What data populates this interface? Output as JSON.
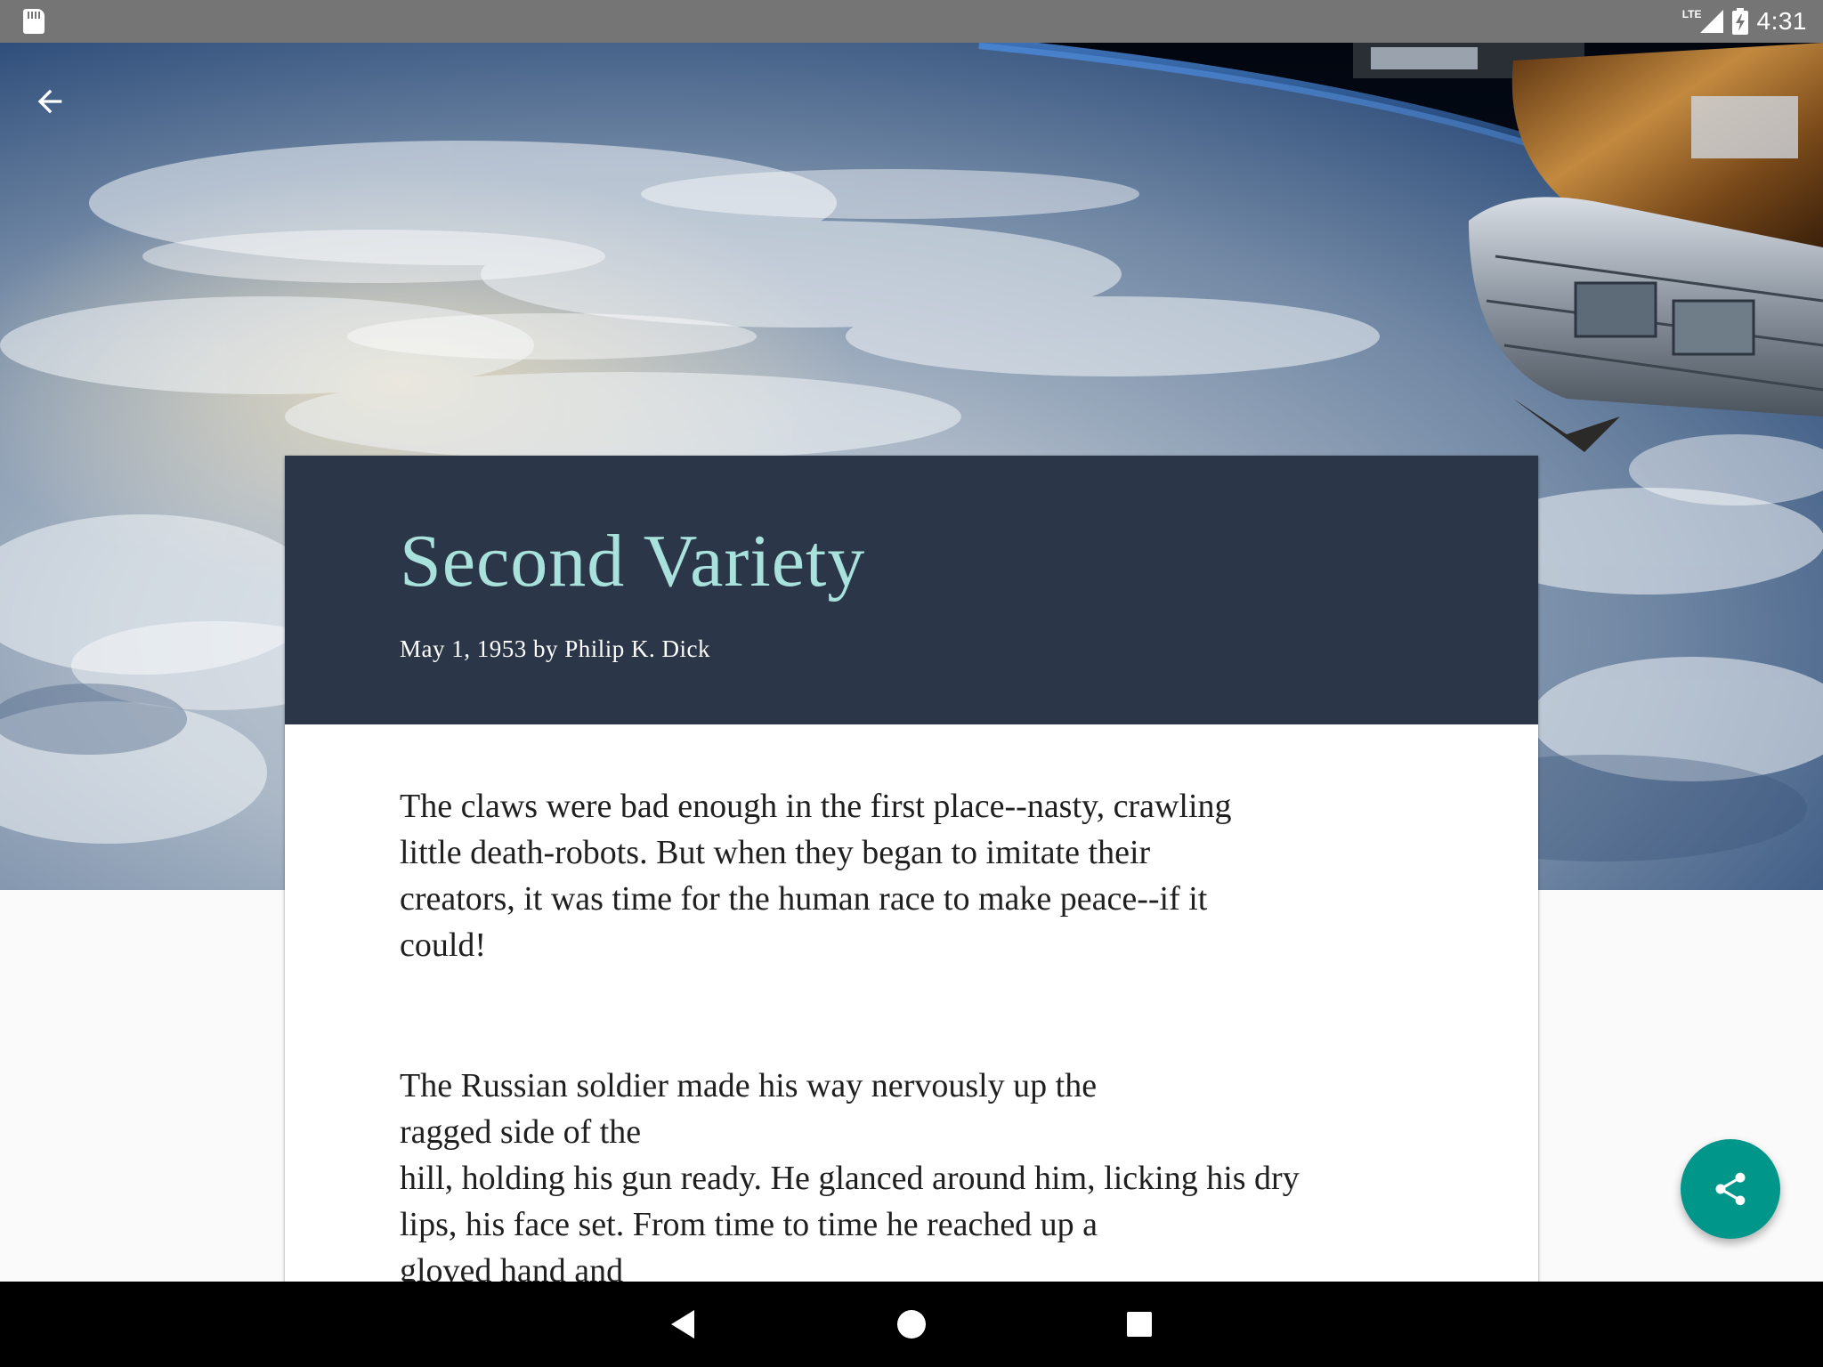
{
  "status_bar": {
    "network_label": "LTE",
    "time": "4:31"
  },
  "hero": {
    "image_description_icon": "earth-from-space-image"
  },
  "toolbar": {
    "back_icon": "arrow-back-icon"
  },
  "article": {
    "title": "Second Variety",
    "meta": "May 1, 1953 by Philip K. Dick",
    "summary": "The claws were bad enough in the first place--nasty, crawling\nlittle death-robots. But when they began to imitate their\ncreators, it was time for the human race to make peace--if it\ncould!",
    "body": "The Russian soldier made his way nervously up the\nragged side of the\nhill, holding his gun ready. He glanced around him, licking his dry\nlips, his face set. From time to time he reached up a\ngloved hand and"
  },
  "fab": {
    "icon": "share-icon"
  },
  "colors": {
    "header_bg": "#2b3749",
    "title_color": "#a9e2dc",
    "fab_bg": "#00968a",
    "status_bar_bg": "#757575"
  },
  "nav_bar": {
    "back_icon": "nav-back-icon",
    "home_icon": "nav-home-icon",
    "recents_icon": "nav-recents-icon"
  }
}
